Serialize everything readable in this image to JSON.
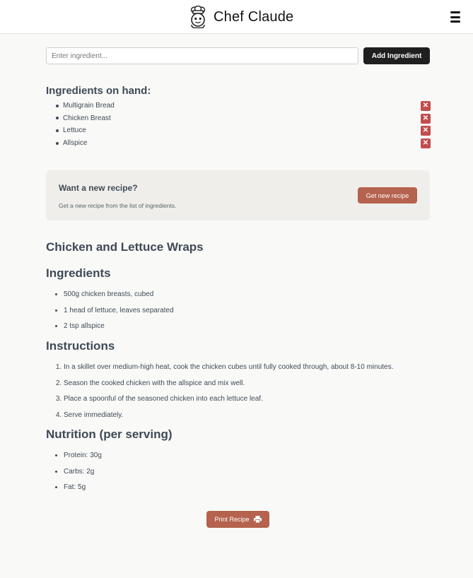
{
  "header": {
    "title": "Chef Claude"
  },
  "input": {
    "placeholder": "Enter ingredient...",
    "add_label": "Add Ingredient"
  },
  "on_hand": {
    "title": "Ingredients on hand:",
    "items": [
      "Multigrain Bread",
      "Chicken Breast",
      "Lettuce",
      "Allspice"
    ],
    "remove_symbol": "✕"
  },
  "cta": {
    "title": "Want a new recipe?",
    "subtitle": "Get a new recipe from the list of ingredients.",
    "button_label": "Get new recipe"
  },
  "recipe": {
    "title": "Chicken and Lettuce Wraps",
    "ingredients_heading": "Ingredients",
    "ingredients": [
      "500g chicken breasts, cubed",
      "1 head of lettuce, leaves separated",
      "2 tsp allspice"
    ],
    "instructions_heading": "Instructions",
    "instructions": [
      "In a skillet over medium-high heat, cook the chicken cubes until fully cooked through, about 8-10 minutes.",
      "Season the cooked chicken with the allspice and mix well.",
      "Place a spoonful of the seasoned chicken into each lettuce leaf.",
      "Serve immediately."
    ],
    "nutrition_heading": "Nutrition (per serving)",
    "nutrition": [
      "Protein: 30g",
      "Carbs: 2g",
      "Fat: 5g"
    ]
  },
  "print": {
    "label": "Print Recipe"
  },
  "colors": {
    "background": "#f9f9f7",
    "accent": "#b5624f",
    "danger": "#c14d4d",
    "dark_button": "#1f1f1f"
  }
}
